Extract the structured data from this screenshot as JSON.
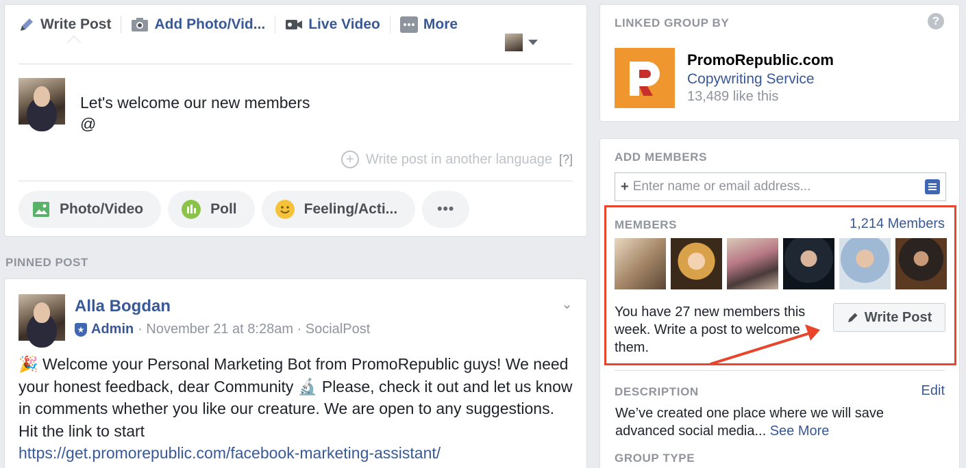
{
  "composer": {
    "tabs": [
      {
        "label": "Write Post",
        "icon": "pencil-icon"
      },
      {
        "label": "Add Photo/Vid...",
        "icon": "camera-icon"
      },
      {
        "label": "Live Video",
        "icon": "video-camera-icon"
      },
      {
        "label": "More",
        "icon": "more-icon"
      }
    ],
    "post_text_line1": "Let's welcome our new members",
    "post_text_line2": "@",
    "write_language": "Write post in another language",
    "language_help": "[?]",
    "actions": [
      {
        "label": "Photo/Video",
        "icon": "photo-icon",
        "color": "#58b368"
      },
      {
        "label": "Poll",
        "icon": "poll-icon",
        "color": "#6ab04c"
      },
      {
        "label": "Feeling/Acti...",
        "icon": "smile-icon",
        "color": "#f5c33b"
      },
      {
        "label": "•••",
        "icon": "more-dots-icon"
      }
    ]
  },
  "pinned_label": "PINNED POST",
  "post": {
    "author": "Alla Bogdan",
    "role": "Admin",
    "meta": "· November 21 at 8:28am · SocialPost",
    "body": "🎉 Welcome your Personal Marketing Bot from PromoRepublic guys! We need your honest feedback, dear Community 🔬 Please, check it out and let us know in comments whether you like our creature. We are open to any suggestions. Hit the link to start",
    "link": "https://get.promorepublic.com/facebook-marketing-assistant/"
  },
  "linked": {
    "heading": "LINKED GROUP BY",
    "help": "?",
    "page_name": "PromoRepublic.com",
    "category": "Copywriting Service",
    "likes": "13,489 like this"
  },
  "members": {
    "add_heading": "ADD MEMBERS",
    "input_placeholder": "Enter name or email address...",
    "heading": "MEMBERS",
    "count": "1,214 Members",
    "new_text": "You have 27 new members this week. Write a post to welcome them.",
    "write_post": "Write Post",
    "accent": "#e8452c"
  },
  "description": {
    "heading": "DESCRIPTION",
    "edit": "Edit",
    "text": "We’ve created one place where we will save advanced social media...",
    "see_more": "See More"
  },
  "group_type": {
    "heading": "GROUP TYPE"
  }
}
